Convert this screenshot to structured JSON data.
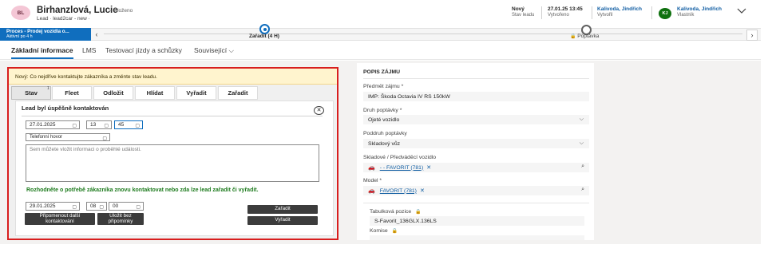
{
  "header": {
    "avatar_initials": "BL",
    "record_name": "Birhanzlová, Lucie",
    "save_status": "– Uloženo",
    "breadcrumb": "Lead · lead2car - new ·",
    "status_value": "Nový",
    "status_label": "Stav leadu",
    "created_value": "27.01.25 13:45",
    "created_label": "Vytvořeno",
    "created_by_value": "Kalivoda, Jindřich",
    "created_by_label": "Vytvořil",
    "owner_initials": "KJ",
    "owner_value": "Kalivoda, Jindřich",
    "owner_label": "Vlastník",
    "expand_icon": "chevron-down-icon"
  },
  "process": {
    "name": "Proces - Prodej vozidla o...",
    "active_text": "Aktivní po 4 h",
    "prev_glyph": "‹",
    "next_glyph": "›",
    "stage1_label": "Zařadit  (4 H)",
    "stage2_label": "Poptávka",
    "stage2_lock_glyph": "🔒",
    "active_color": "#106ebe"
  },
  "tabs": {
    "basic": "Základní informace",
    "lms": "LMS",
    "test": "Testovací jízdy a schůzky",
    "related": "Související ⌵"
  },
  "left": {
    "notice": "Nový: Co nejdříve kontaktujte zákazníka a změnte stav leadu.",
    "subtabs": [
      "Stav",
      "Fleet",
      "Odložit",
      "Hlídat",
      "Vyřadit",
      "Zařadit"
    ],
    "stav_badge": "1",
    "inner_title": "Lead byl úspěšně kontaktován",
    "close_glyph": "✕",
    "date1": "27.01.2025",
    "hour1": "13",
    "minute1": "45",
    "contact_type": "Telefonní hovor",
    "note_placeholder": "Sem můžete vložit informaci o proběhlé události.",
    "question": "Rozhodněte o potřebě zákazníka znovu kontaktovat nebo zda lze lead zařadit či vyřadit.",
    "date2": "29.01.2025",
    "hour2": "08",
    "minute2": "00",
    "btn_remind": "Připomenout další kontaktování",
    "btn_save_noremind": "Uložit bez připomínky",
    "btn_assign": "Zařadit",
    "btn_discard": "Vyřadit",
    "calendar_glyph": "▢",
    "alert_color": "#d81e1e"
  },
  "right": {
    "section_title": "POPIS ZÁJMU",
    "subject_label": "Předmět zájmu *",
    "subject_value": "IMP: Škoda Octavia IV RS 150kW",
    "inquiry_type_label": "Druh poptávky *",
    "inquiry_type_value": "Ojeté vozidlo",
    "inquiry_subtype_label": "Poddruh poptávky",
    "inquiry_subtype_value": "Skladový vůz",
    "stock_vehicle_label": "Skladové / Předváděcí vozidlo",
    "stock_vehicle_value": "- - FAVORIT (781)",
    "model_label": "Model *",
    "model_value": "FAVORIT (781)",
    "table_position_label": "Tabulková pozice",
    "table_position_value": "S-Favorit_136GLX.136LS",
    "commission_label": "Komise",
    "chevron_glyph": "⌵",
    "search_glyph": "⌕",
    "car_glyph": "🚗",
    "clear_glyph": "✕",
    "lock_glyph": "🔒"
  }
}
